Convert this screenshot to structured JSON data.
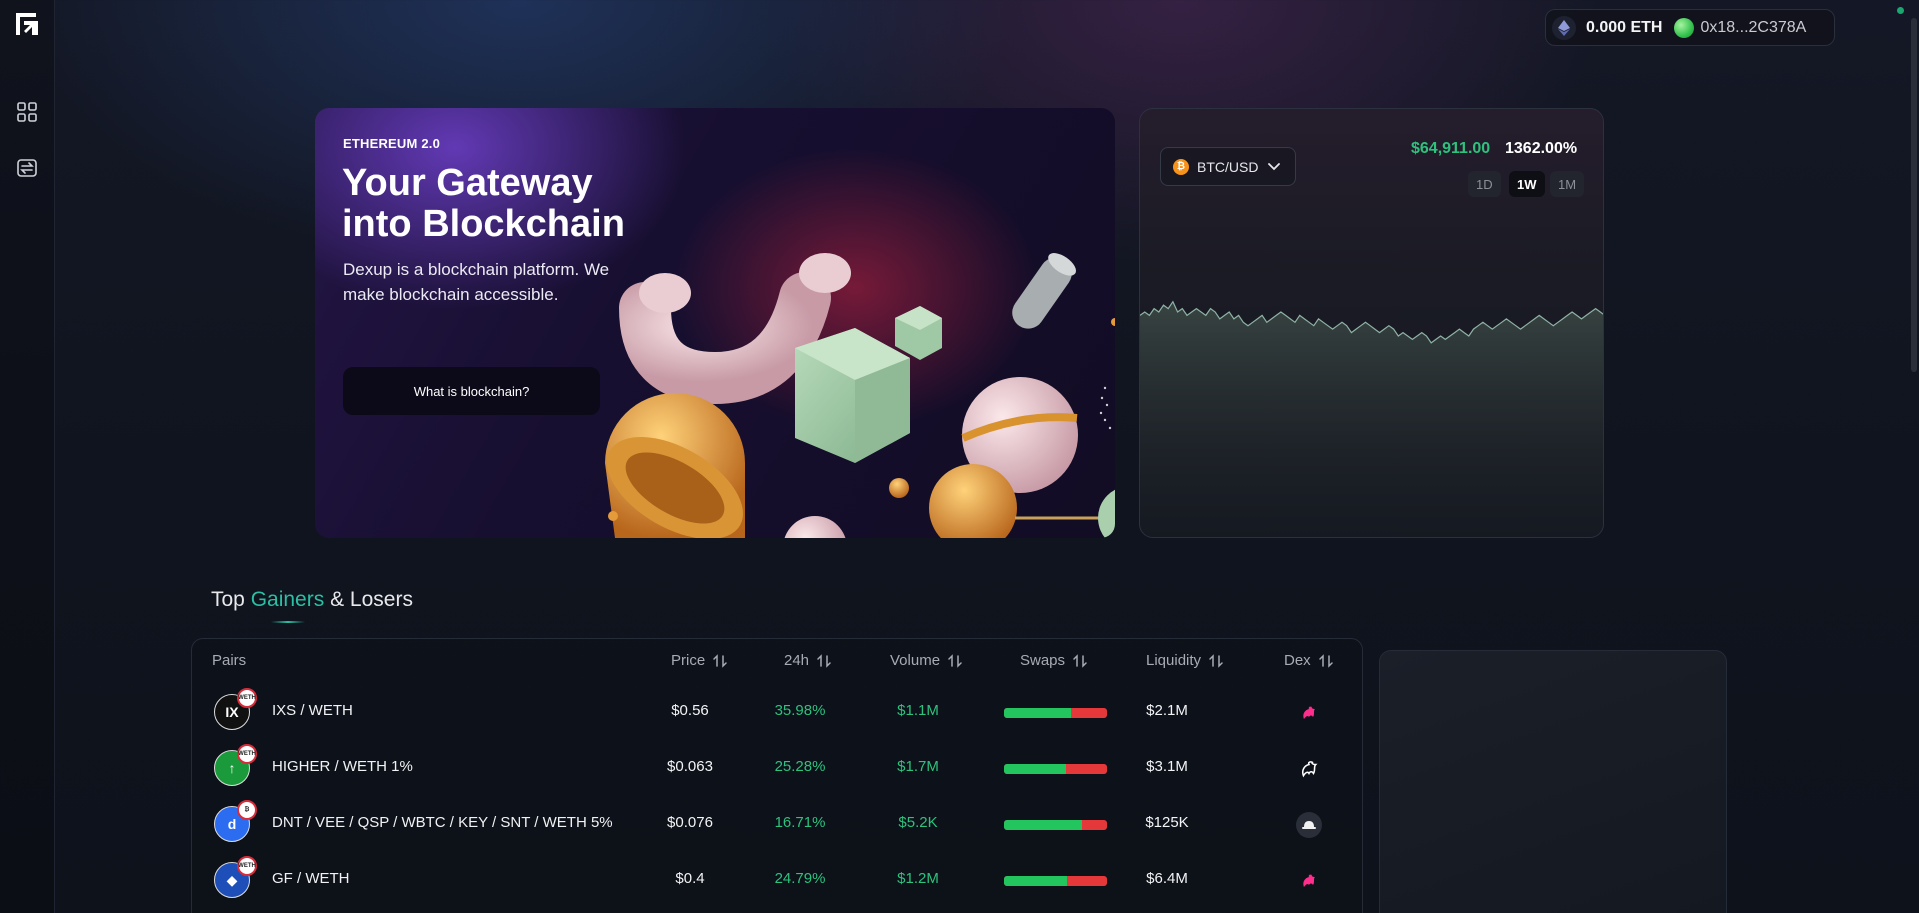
{
  "wallet": {
    "eth_balance": "0.000 ETH",
    "address": "0x18...2C378A"
  },
  "sidebar": {
    "icons": [
      "dashboard-icon",
      "swap-icon"
    ]
  },
  "hero": {
    "eyebrow": "ETHEREUM 2.0",
    "title": "Your Gateway into Blockchain",
    "subtitle": "Dexup is a blockchain platform. We make blockchain accessible.",
    "cta_label": "What is blockchain?"
  },
  "price_card": {
    "pair": "BTC/USD",
    "price": "$64,911.00",
    "change": "1362.00%",
    "timeframes": [
      {
        "label": "1D",
        "active": false
      },
      {
        "label": "1W",
        "active": true
      },
      {
        "label": "1M",
        "active": false
      }
    ]
  },
  "chart_data": {
    "type": "area",
    "values": [
      60,
      61,
      60,
      62,
      61,
      63,
      62,
      64,
      61,
      62,
      60,
      61,
      62,
      61,
      60,
      62,
      61,
      59,
      60,
      61,
      59,
      60,
      58,
      57,
      58,
      59,
      60,
      58,
      59,
      60,
      61,
      60,
      59,
      58,
      60,
      59,
      58,
      57,
      59,
      58,
      57,
      56,
      57,
      58,
      57,
      55,
      56,
      57,
      58,
      57,
      56,
      55,
      56,
      57,
      56,
      54,
      55,
      54,
      53,
      54,
      55,
      54,
      52,
      53,
      54,
      53,
      54,
      55,
      56,
      55,
      54,
      56,
      57,
      58,
      57,
      56,
      57,
      58,
      59,
      58,
      57,
      56,
      57,
      58,
      59,
      60,
      59,
      58,
      57,
      58,
      59,
      60,
      61,
      60,
      59,
      60,
      61,
      62,
      61,
      60
    ]
  },
  "section": {
    "title_pre": "Top ",
    "title_accent": "Gainers",
    "title_post": " & Losers"
  },
  "table": {
    "headers": {
      "pairs": "Pairs",
      "price": "Price",
      "change": "24h",
      "volume": "Volume",
      "swaps": "Swaps",
      "liquidity": "Liquidity",
      "dex": "Dex"
    },
    "rows": [
      {
        "pair": "IXS / WETH",
        "price": "$0.56",
        "change": "35.98%",
        "volume": "$1.1M",
        "buy_ratio": 0.65,
        "liquidity": "$2.1M",
        "dex": "uniswap",
        "token_color": "#111111",
        "token_glyph": "IX",
        "badge": "WETH"
      },
      {
        "pair": "HIGHER / WETH 1%",
        "price": "$0.063",
        "change": "25.28%",
        "volume": "$1.7M",
        "buy_ratio": 0.6,
        "liquidity": "$3.1M",
        "dex": "uniswap-white",
        "token_color": "#1a9a3a",
        "token_glyph": "↑",
        "badge": "WETH"
      },
      {
        "pair": "DNT / VEE / QSP / WBTC / KEY / SNT / WETH 5%",
        "price": "$0.076",
        "change": "16.71%",
        "volume": "$5.2K",
        "buy_ratio": 0.76,
        "liquidity": "$125K",
        "dex": "sushi-hat",
        "token_color": "#2b6cf0",
        "token_glyph": "d",
        "badge": "₿"
      },
      {
        "pair": "GF / WETH",
        "price": "$0.4",
        "change": "24.79%",
        "volume": "$1.2M",
        "buy_ratio": 0.61,
        "liquidity": "$6.4M",
        "dex": "uniswap",
        "token_color": "#1e4fb8",
        "token_glyph": "◆",
        "badge": "WETH"
      }
    ]
  }
}
